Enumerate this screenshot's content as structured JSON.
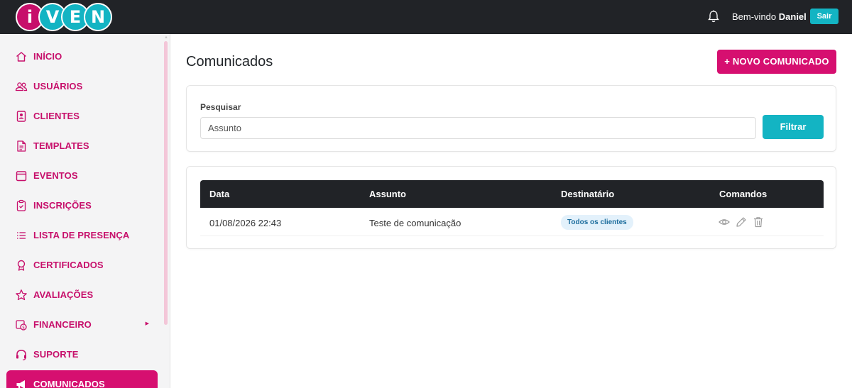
{
  "topbar": {
    "logo_letters": [
      "i",
      "V",
      "E",
      "N"
    ],
    "logo_colors": [
      "#c70f6b",
      "#13b4c3",
      "#13b4c3",
      "#13b4c3"
    ],
    "welcome_prefix": "Bem-vindo",
    "user_name": "Daniel",
    "logout_label": "Sair"
  },
  "sidebar": {
    "items": [
      {
        "label": "INÍCIO",
        "icon": "home-icon"
      },
      {
        "label": "USUÁRIOS",
        "icon": "users-icon"
      },
      {
        "label": "CLIENTES",
        "icon": "contact-card-icon"
      },
      {
        "label": "TEMPLATES",
        "icon": "document-icon"
      },
      {
        "label": "EVENTOS",
        "icon": "calendar-icon"
      },
      {
        "label": "INSCRIÇÕES",
        "icon": "clipboard-check-icon"
      },
      {
        "label": "LISTA DE PRESENÇA",
        "icon": "list-icon"
      },
      {
        "label": "CERTIFICADOS",
        "icon": "award-icon"
      },
      {
        "label": "AVALIAÇÕES",
        "icon": "star-icon"
      },
      {
        "label": "FINANCEIRO",
        "icon": "finance-icon",
        "has_submenu": true
      },
      {
        "label": "SUPORTE",
        "icon": "headset-icon"
      },
      {
        "label": "COMUNICADOS",
        "icon": "megaphone-icon",
        "active": true
      }
    ]
  },
  "main": {
    "title": "Comunicados",
    "new_button_label": "+ NOVO COMUNICADO",
    "search": {
      "label": "Pesquisar",
      "placeholder": "Assunto",
      "filter_label": "Filtrar"
    },
    "table": {
      "headers": [
        "Data",
        "Assunto",
        "Destinatário",
        "Comandos"
      ],
      "rows": [
        {
          "date": "01/08/2026 22:43",
          "subject": "Teste de comunicação",
          "recipient": "Todos os clientes",
          "commands": [
            "view-icon",
            "edit-icon",
            "delete-icon"
          ]
        }
      ]
    }
  },
  "colors": {
    "brand_pink": "#d60f70",
    "brand_cyan": "#13b4c3",
    "dark_header": "#212327"
  }
}
